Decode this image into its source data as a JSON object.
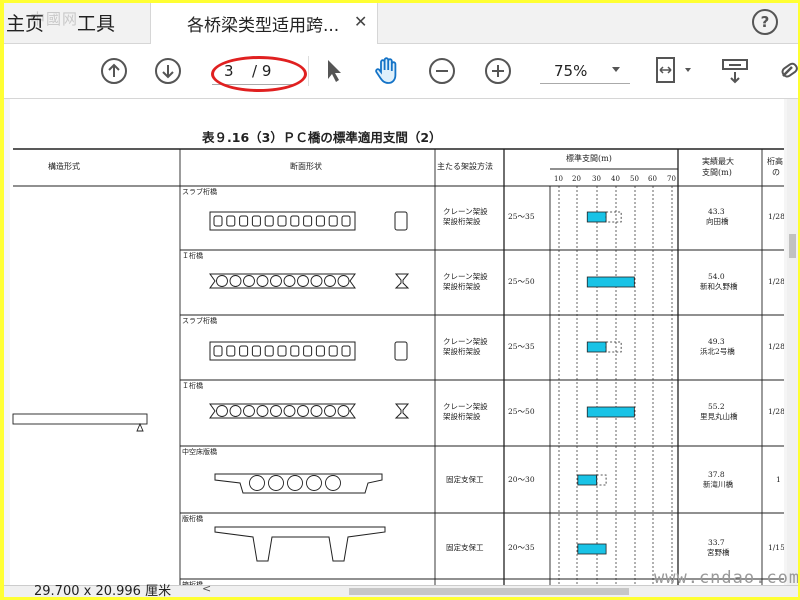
{
  "tabs": {
    "home": "主页",
    "tools": "工具",
    "document": "各桥梁类型适用跨...",
    "watermark_top": "中國网"
  },
  "toolbar": {
    "page_current": "3",
    "page_total": "/ 9",
    "zoom": "75%"
  },
  "status": {
    "page_size": "29.700 x 20.996 厘米"
  },
  "watermark_bottom": "www.cndao.com",
  "table": {
    "title": "表９.16（3）ＰＣ橋の標準適用支間（2）",
    "headers": {
      "structure": "構造形式",
      "section": "断面形状",
      "erection": "主たる架設方法",
      "span": "標準支間(m)",
      "record_1": "実績最大",
      "record_2": "支間(m)",
      "ratio_1": "桁高",
      "ratio_2": "の"
    },
    "ticks": [
      "10",
      "20",
      "30",
      "40",
      "50",
      "60",
      "70"
    ],
    "rows": [
      {
        "type": "スラブ桁橋",
        "method_1": "クレーン架設",
        "method_2": "架設桁架設",
        "range": "25～35",
        "record": "43.3",
        "bridge": "向田橋",
        "ratio": "1/28",
        "bar": [
          25,
          35
        ],
        "dash": [
          35,
          43
        ]
      },
      {
        "type": "Ｉ桁橋",
        "method_1": "クレーン架設",
        "method_2": "架設桁架設",
        "range": "25～50",
        "record": "54.0",
        "bridge": "新和久野橋",
        "ratio": "1/28",
        "bar": [
          25,
          50
        ],
        "dash": null
      },
      {
        "type": "スラブ桁橋",
        "method_1": "クレーン架設",
        "method_2": "架設桁架設",
        "range": "25～35",
        "record": "49.3",
        "bridge": "浜北2号橋",
        "ratio": "1/28",
        "bar": [
          25,
          35
        ],
        "dash": [
          35,
          43
        ]
      },
      {
        "type": "Ｉ桁橋",
        "method_1": "クレーン架設",
        "method_2": "架設桁架設",
        "range": "25～50",
        "record": "55.2",
        "bridge": "里見丸山橋",
        "ratio": "1/28",
        "bar": [
          25,
          50
        ],
        "dash": null
      },
      {
        "type": "中空床版橋",
        "method_1": "固定支保工",
        "method_2": "",
        "range": "20～30",
        "record": "37.8",
        "bridge": "新滝川橋",
        "ratio": "1",
        "bar": [
          20,
          30
        ],
        "dash": [
          30,
          35
        ]
      },
      {
        "type": "版桁橋",
        "method_1": "固定支保工",
        "method_2": "",
        "range": "20～35",
        "record": "33.7",
        "bridge": "宮野橋",
        "ratio": "1/15",
        "bar": [
          20,
          35
        ],
        "dash": null
      },
      {
        "type": "箱桁橋",
        "method_1": "",
        "method_2": "",
        "range": "",
        "record": "",
        "bridge": "",
        "ratio": "",
        "bar": null,
        "dash": null
      }
    ]
  },
  "colors": {
    "bar_fill": "#19c3e6",
    "annotation": "#e02020"
  }
}
